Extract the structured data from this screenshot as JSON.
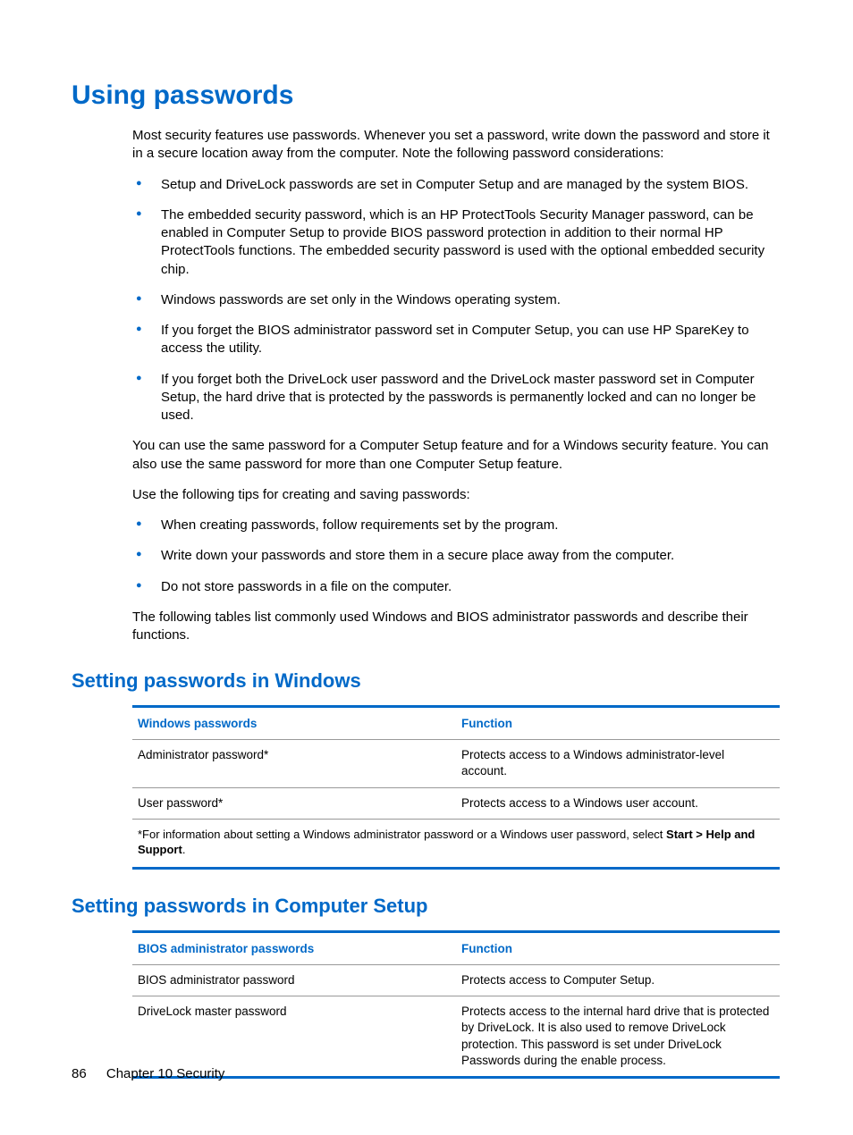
{
  "heading": "Using passwords",
  "intro": "Most security features use passwords. Whenever you set a password, write down the password and store it in a secure location away from the computer. Note the following password considerations:",
  "bullets1": [
    "Setup and DriveLock passwords are set in Computer Setup and are managed by the system BIOS.",
    "The embedded security password, which is an HP ProtectTools Security Manager password, can be enabled in Computer Setup to provide BIOS password protection in addition to their normal HP ProtectTools functions. The embedded security password is used with the optional embedded security chip.",
    "Windows passwords are set only in the Windows operating system.",
    "If you forget the BIOS administrator password set in Computer Setup, you can use HP SpareKey to access the utility.",
    "If you forget both the DriveLock user password and the DriveLock master password set in Computer Setup, the hard drive that is protected by the passwords is permanently locked and can no longer be used."
  ],
  "para2": "You can use the same password for a Computer Setup feature and for a Windows security feature. You can also use the same password for more than one Computer Setup feature.",
  "para3": "Use the following tips for creating and saving passwords:",
  "bullets2": [
    "When creating passwords, follow requirements set by the program.",
    "Write down your passwords and store them in a secure place away from the computer.",
    "Do not store passwords in a file on the computer."
  ],
  "para4": "The following tables list commonly used Windows and BIOS administrator passwords and describe their functions.",
  "section1": {
    "title": "Setting passwords in Windows",
    "col1": "Windows passwords",
    "col2": "Function",
    "rows": [
      {
        "c1": "Administrator password*",
        "c2": "Protects access to a Windows administrator-level account."
      },
      {
        "c1": "User password*",
        "c2": "Protects access to a Windows user account."
      }
    ],
    "footnote_pre": "*For information about setting a Windows administrator password or a Windows user password, select ",
    "footnote_bold": "Start > Help and Support",
    "footnote_post": "."
  },
  "section2": {
    "title": "Setting passwords in Computer Setup",
    "col1": "BIOS administrator passwords",
    "col2": "Function",
    "rows": [
      {
        "c1": "BIOS administrator password",
        "c2": "Protects access to Computer Setup."
      },
      {
        "c1": "DriveLock master password",
        "c2": "Protects access to the internal hard drive that is protected by DriveLock. It is also used to remove DriveLock protection. This password is set under DriveLock Passwords during the enable process."
      }
    ]
  },
  "footer": {
    "page": "86",
    "chapter": "Chapter 10   Security"
  }
}
